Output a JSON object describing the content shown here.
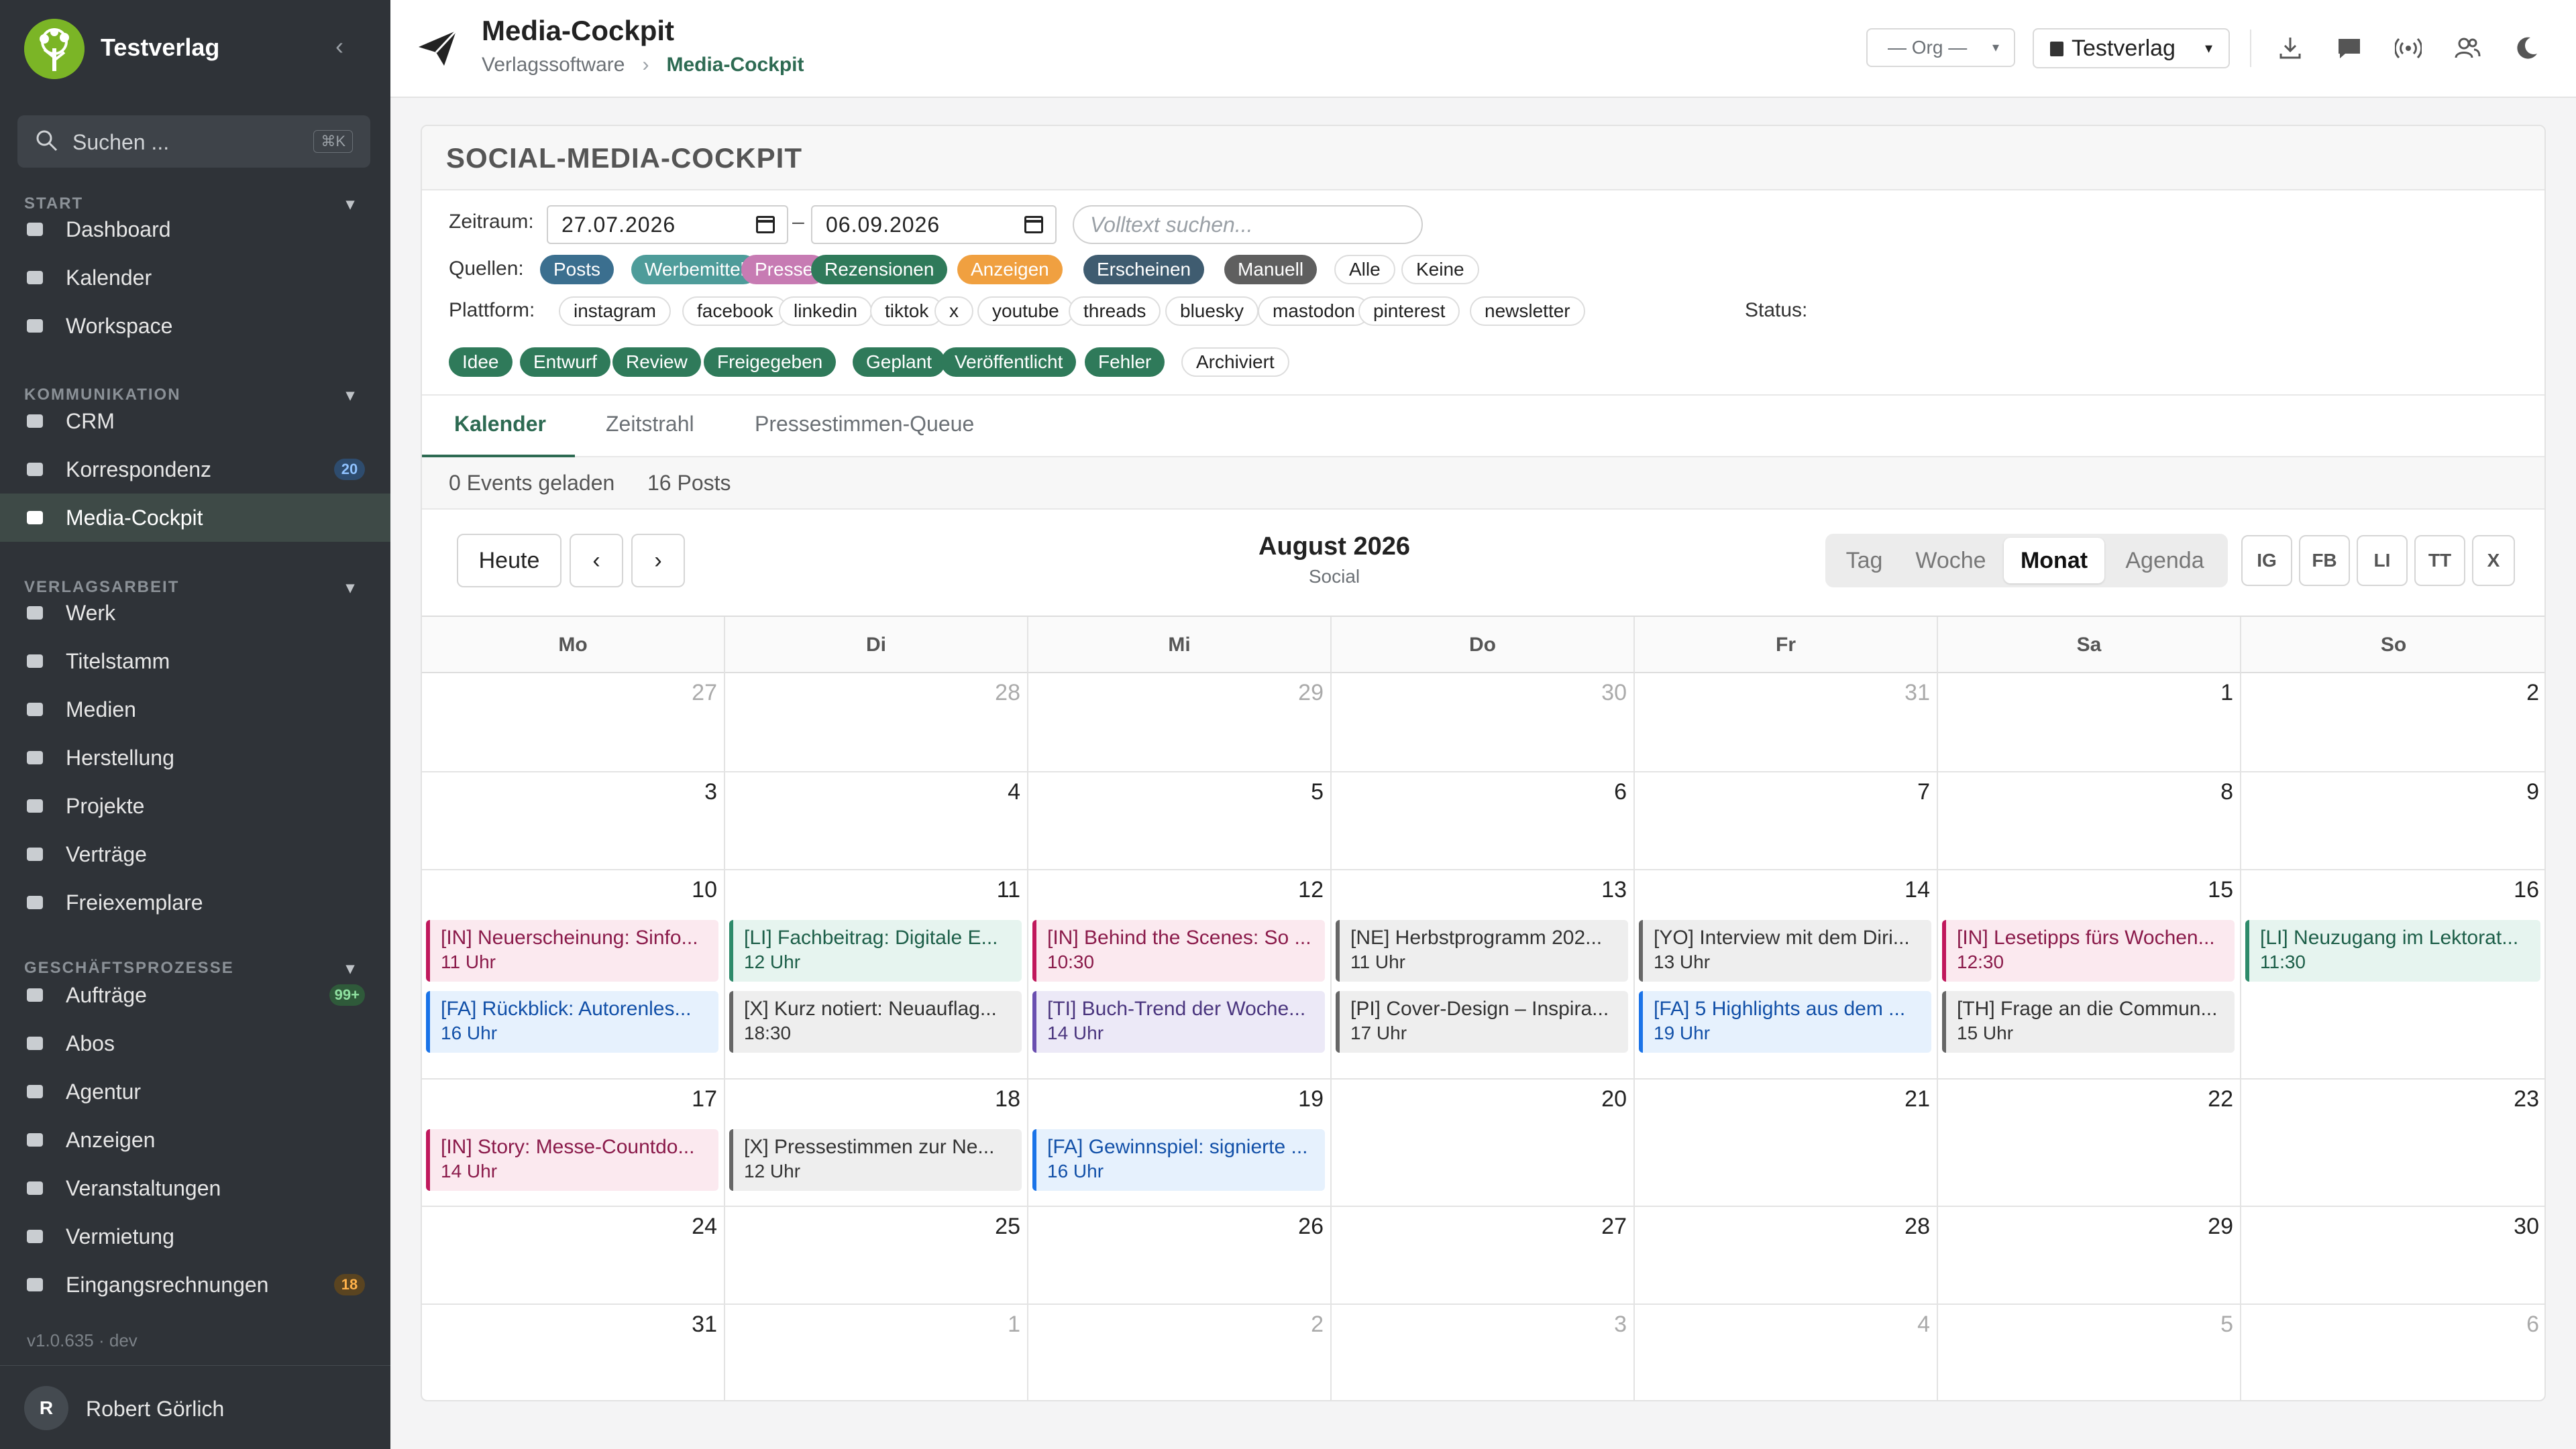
{
  "sidebar": {
    "brand": "Testverlag",
    "search_label": "Suchen ...",
    "search_shortcut": "⌘K",
    "sections": [
      {
        "title": "START",
        "items": [
          {
            "label": "Dashboard",
            "icon": "dashboard-icon"
          },
          {
            "label": "Kalender",
            "icon": "calendar-icon"
          },
          {
            "label": "Workspace",
            "icon": "workspace-icon"
          }
        ]
      },
      {
        "title": "KOMMUNIKATION",
        "items": [
          {
            "label": "CRM",
            "icon": "crm-icon"
          },
          {
            "label": "Korrespondenz",
            "icon": "mail-icon",
            "badge": "20"
          },
          {
            "label": "Media-Cockpit",
            "icon": "paper-plane-icon",
            "active": true
          }
        ]
      },
      {
        "title": "VERLAGSARBEIT",
        "items": [
          {
            "label": "Werk",
            "icon": "bulb-icon"
          },
          {
            "label": "Titelstamm",
            "icon": "books-icon"
          },
          {
            "label": "Medien",
            "icon": "image-icon"
          },
          {
            "label": "Herstellung",
            "icon": "toolbox-icon"
          },
          {
            "label": "Projekte",
            "icon": "projects-icon"
          },
          {
            "label": "Verträge",
            "icon": "contract-icon"
          },
          {
            "label": "Freiexemplare",
            "icon": "feather-icon"
          }
        ]
      },
      {
        "title": "GESCHÄFTSPROZESSE",
        "items": [
          {
            "label": "Aufträge",
            "icon": "orders-icon",
            "badge": "99+"
          },
          {
            "label": "Abos",
            "icon": "subscription-icon"
          },
          {
            "label": "Agentur",
            "icon": "briefcase-icon"
          },
          {
            "label": "Anzeigen",
            "icon": "megaphone-icon"
          },
          {
            "label": "Veranstaltungen",
            "icon": "events-icon"
          },
          {
            "label": "Vermietung",
            "icon": "music-icon"
          },
          {
            "label": "Eingangsrechnungen",
            "icon": "invoice-icon",
            "badge": "18"
          }
        ]
      }
    ],
    "version": "v1.0.635 · dev",
    "user_initial": "R",
    "user_name": "Robert Görlich"
  },
  "topbar": {
    "title": "Media-Cockpit",
    "breadcrumb": [
      "Verlagssoftware",
      "Media-Cockpit"
    ],
    "org_select": "— Org —",
    "publisher_select": "Testverlag",
    "icons": [
      "download-icon",
      "chat-icon",
      "broadcast-icon",
      "users-icon",
      "moon-icon"
    ]
  },
  "panel": {
    "title": "SOCIAL-MEDIA-COCKPIT",
    "zeitraum_label": "Zeitraum:",
    "date_from": "27.07.2026",
    "date_to": "06.09.2026",
    "fulltext_placeholder": "Volltext suchen...",
    "quellen_label": "Quellen:",
    "quellen": [
      {
        "label": "Posts",
        "color": "#3b6f8f"
      },
      {
        "label": "Werbemittel",
        "color": "#4e9c9a"
      },
      {
        "label": "Presse",
        "color": "#c77bb3"
      },
      {
        "label": "Rezensionen",
        "color": "#2f7a5a"
      },
      {
        "label": "Anzeigen",
        "color": "#f0a040"
      },
      {
        "label": "Erscheinen",
        "color": "#3f5c70"
      },
      {
        "label": "Manuell",
        "color": "#5f5f5f"
      }
    ],
    "quellen_all": "Alle",
    "quellen_none": "Keine",
    "plattform_label": "Plattform:",
    "plattformen": [
      "instagram",
      "facebook",
      "linkedin",
      "tiktok",
      "x",
      "youtube",
      "threads",
      "bluesky",
      "mastodon",
      "pinterest",
      "newsletter"
    ],
    "status_label": "Status:",
    "status": [
      {
        "label": "Idee",
        "color": "#2f7a5a"
      },
      {
        "label": "Entwurf",
        "color": "#2f7a5a"
      },
      {
        "label": "Review",
        "color": "#2f7a5a"
      },
      {
        "label": "Freigegeben",
        "color": "#2f7a5a"
      },
      {
        "label": "Geplant",
        "color": "#2f7a5a"
      },
      {
        "label": "Veröffentlicht",
        "color": "#2f7a5a"
      },
      {
        "label": "Fehler",
        "color": "#2f7a5a"
      },
      {
        "label": "Archiviert",
        "color": null
      }
    ],
    "tabs": [
      "Kalender",
      "Zeitstrahl",
      "Pressestimmen-Queue"
    ],
    "events_loaded": "0 Events geladen",
    "posts_count": "16 Posts",
    "today_btn": "Heute",
    "prev_btn": "‹",
    "next_btn": "›",
    "month_title": "August 2026",
    "month_subtitle": "Social",
    "views": [
      "Tag",
      "Woche",
      "Monat",
      "Agenda"
    ],
    "active_view": "Monat",
    "platform_buttons": [
      "IG",
      "FB",
      "LI",
      "TT",
      "X"
    ]
  },
  "calendar": {
    "weekdays": [
      "Mo",
      "Di",
      "Mi",
      "Do",
      "Fr",
      "Sa",
      "So"
    ],
    "weeks": [
      [
        {
          "d": "27",
          "out": true
        },
        {
          "d": "28",
          "out": true
        },
        {
          "d": "29",
          "out": true
        },
        {
          "d": "30",
          "out": true
        },
        {
          "d": "31",
          "out": true
        },
        {
          "d": "1"
        },
        {
          "d": "2"
        }
      ],
      [
        {
          "d": "3"
        },
        {
          "d": "4"
        },
        {
          "d": "5"
        },
        {
          "d": "6"
        },
        {
          "d": "7"
        },
        {
          "d": "8"
        },
        {
          "d": "9"
        }
      ],
      [
        {
          "d": "10",
          "ev": [
            {
              "t": "[IN] Neuerscheinung: Sinfo...",
              "tm": "11 Uhr",
              "c": "pink"
            },
            {
              "t": "[FA] Rückblick: Autorenles...",
              "tm": "16 Uhr",
              "c": "blue"
            }
          ]
        },
        {
          "d": "11",
          "ev": [
            {
              "t": "[LI] Fachbeitrag: Digitale E...",
              "tm": "12 Uhr",
              "c": "green"
            },
            {
              "t": "[X] Kurz notiert: Neuauflag...",
              "tm": "18:30",
              "c": "gray"
            }
          ]
        },
        {
          "d": "12",
          "ev": [
            {
              "t": "[IN] Behind the Scenes: So ...",
              "tm": "10:30",
              "c": "pink"
            },
            {
              "t": "[TI] Buch-Trend der Woche...",
              "tm": "14 Uhr",
              "c": "lilac"
            }
          ]
        },
        {
          "d": "13",
          "ev": [
            {
              "t": "[NE] Herbstprogramm 202...",
              "tm": "11 Uhr",
              "c": "gray"
            },
            {
              "t": "[PI] Cover-Design – Inspira...",
              "tm": "17 Uhr",
              "c": "gray"
            }
          ]
        },
        {
          "d": "14",
          "ev": [
            {
              "t": "[YO] Interview mit dem Diri...",
              "tm": "13 Uhr",
              "c": "gray"
            },
            {
              "t": "[FA] 5 Highlights aus dem ...",
              "tm": "19 Uhr",
              "c": "blue"
            }
          ]
        },
        {
          "d": "15",
          "ev": [
            {
              "t": "[IN] Lesetipps fürs Wochen...",
              "tm": "12:30",
              "c": "pink"
            },
            {
              "t": "[TH] Frage an die Commun...",
              "tm": "15 Uhr",
              "c": "gray"
            }
          ]
        },
        {
          "d": "16",
          "ev": [
            {
              "t": "[LI] Neuzugang im Lektorat...",
              "tm": "11:30",
              "c": "green"
            }
          ]
        }
      ],
      [
        {
          "d": "17",
          "ev": [
            {
              "t": "[IN] Story: Messe-Countdo...",
              "tm": "14 Uhr",
              "c": "pink"
            }
          ]
        },
        {
          "d": "18",
          "ev": [
            {
              "t": "[X] Pressestimmen zur Ne...",
              "tm": "12 Uhr",
              "c": "gray"
            }
          ]
        },
        {
          "d": "19",
          "ev": [
            {
              "t": "[FA] Gewinnspiel: signierte ...",
              "tm": "16 Uhr",
              "c": "blue"
            }
          ]
        },
        {
          "d": "20"
        },
        {
          "d": "21"
        },
        {
          "d": "22"
        },
        {
          "d": "23"
        }
      ],
      [
        {
          "d": "24"
        },
        {
          "d": "25"
        },
        {
          "d": "26"
        },
        {
          "d": "27"
        },
        {
          "d": "28"
        },
        {
          "d": "29"
        },
        {
          "d": "30"
        }
      ],
      [
        {
          "d": "31"
        },
        {
          "d": "1",
          "out": true
        },
        {
          "d": "2",
          "out": true
        },
        {
          "d": "3",
          "out": true
        },
        {
          "d": "4",
          "out": true
        },
        {
          "d": "5",
          "out": true
        },
        {
          "d": "6",
          "out": true
        }
      ]
    ]
  }
}
